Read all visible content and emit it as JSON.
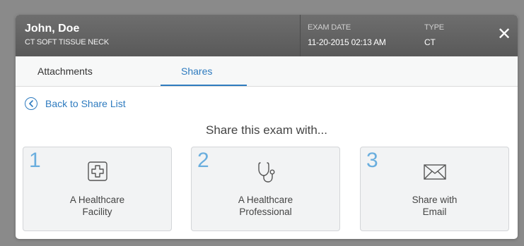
{
  "header": {
    "patient_name": "John, Doe",
    "exam_description": "CT SOFT TISSUE NECK",
    "exam_date_label": "EXAM DATE",
    "exam_date_value": "11-20-2015 02:13 AM",
    "type_label": "TYPE",
    "type_value": "CT",
    "close_glyph": "✕"
  },
  "tabs": [
    {
      "label": "Attachments",
      "active": false
    },
    {
      "label": "Shares",
      "active": true
    }
  ],
  "back_link": {
    "label": "Back to Share List",
    "icon": "chevron-left-circle-icon"
  },
  "share_title": "Share this exam with...",
  "options": [
    {
      "number": "1",
      "line1": "A Healthcare",
      "line2": "Facility",
      "icon": "hospital-cross-icon"
    },
    {
      "number": "2",
      "line1": "A Healthcare",
      "line2": "Professional",
      "icon": "stethoscope-icon"
    },
    {
      "number": "3",
      "line1": "Share with",
      "line2": "Email",
      "icon": "envelope-icon"
    }
  ],
  "colors": {
    "accent": "#2e7bbf",
    "number": "#6aaede",
    "header_bg": "#626262"
  }
}
